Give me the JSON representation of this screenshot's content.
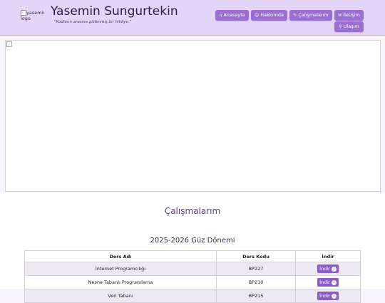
{
  "header": {
    "logo_alt": "yasemin logo",
    "title": "Yasemin Sungurtekin",
    "tagline": "\"Kodların arasına gizlenmiş bir hikâye.\""
  },
  "nav": [
    {
      "label": "Anasayfa",
      "icon": "home-icon",
      "glyph": "⌂"
    },
    {
      "label": "Hakkımda",
      "icon": "user-circle-icon",
      "glyph": "☺"
    },
    {
      "label": "Çalışmalarım",
      "icon": "pencil-icon",
      "glyph": "✎"
    },
    {
      "label": "İletişim",
      "icon": "envelope-icon",
      "glyph": "✉"
    },
    {
      "label": "Ulaşım",
      "icon": "map-pin-icon",
      "glyph": "⚲"
    }
  ],
  "section": {
    "title": "Çalışmalarım",
    "term": "2025-2026 Güz Dönemi"
  },
  "table": {
    "headers": [
      "Ders Adı",
      "Ders Kodu",
      "İndir"
    ],
    "rows": [
      {
        "name": "İnternet Programcılığı",
        "code": "BP227",
        "action": "İndir"
      },
      {
        "name": "Nesne Tabanlı Programlama",
        "code": "BP210",
        "action": "İndir"
      },
      {
        "name": "Veri Tabanı",
        "code": "BP215",
        "action": "İndir"
      }
    ]
  },
  "colors": {
    "header_bg": "#e4d4f7",
    "button_bg": "#9b6fd0",
    "accent_text": "#5a3c8c"
  }
}
